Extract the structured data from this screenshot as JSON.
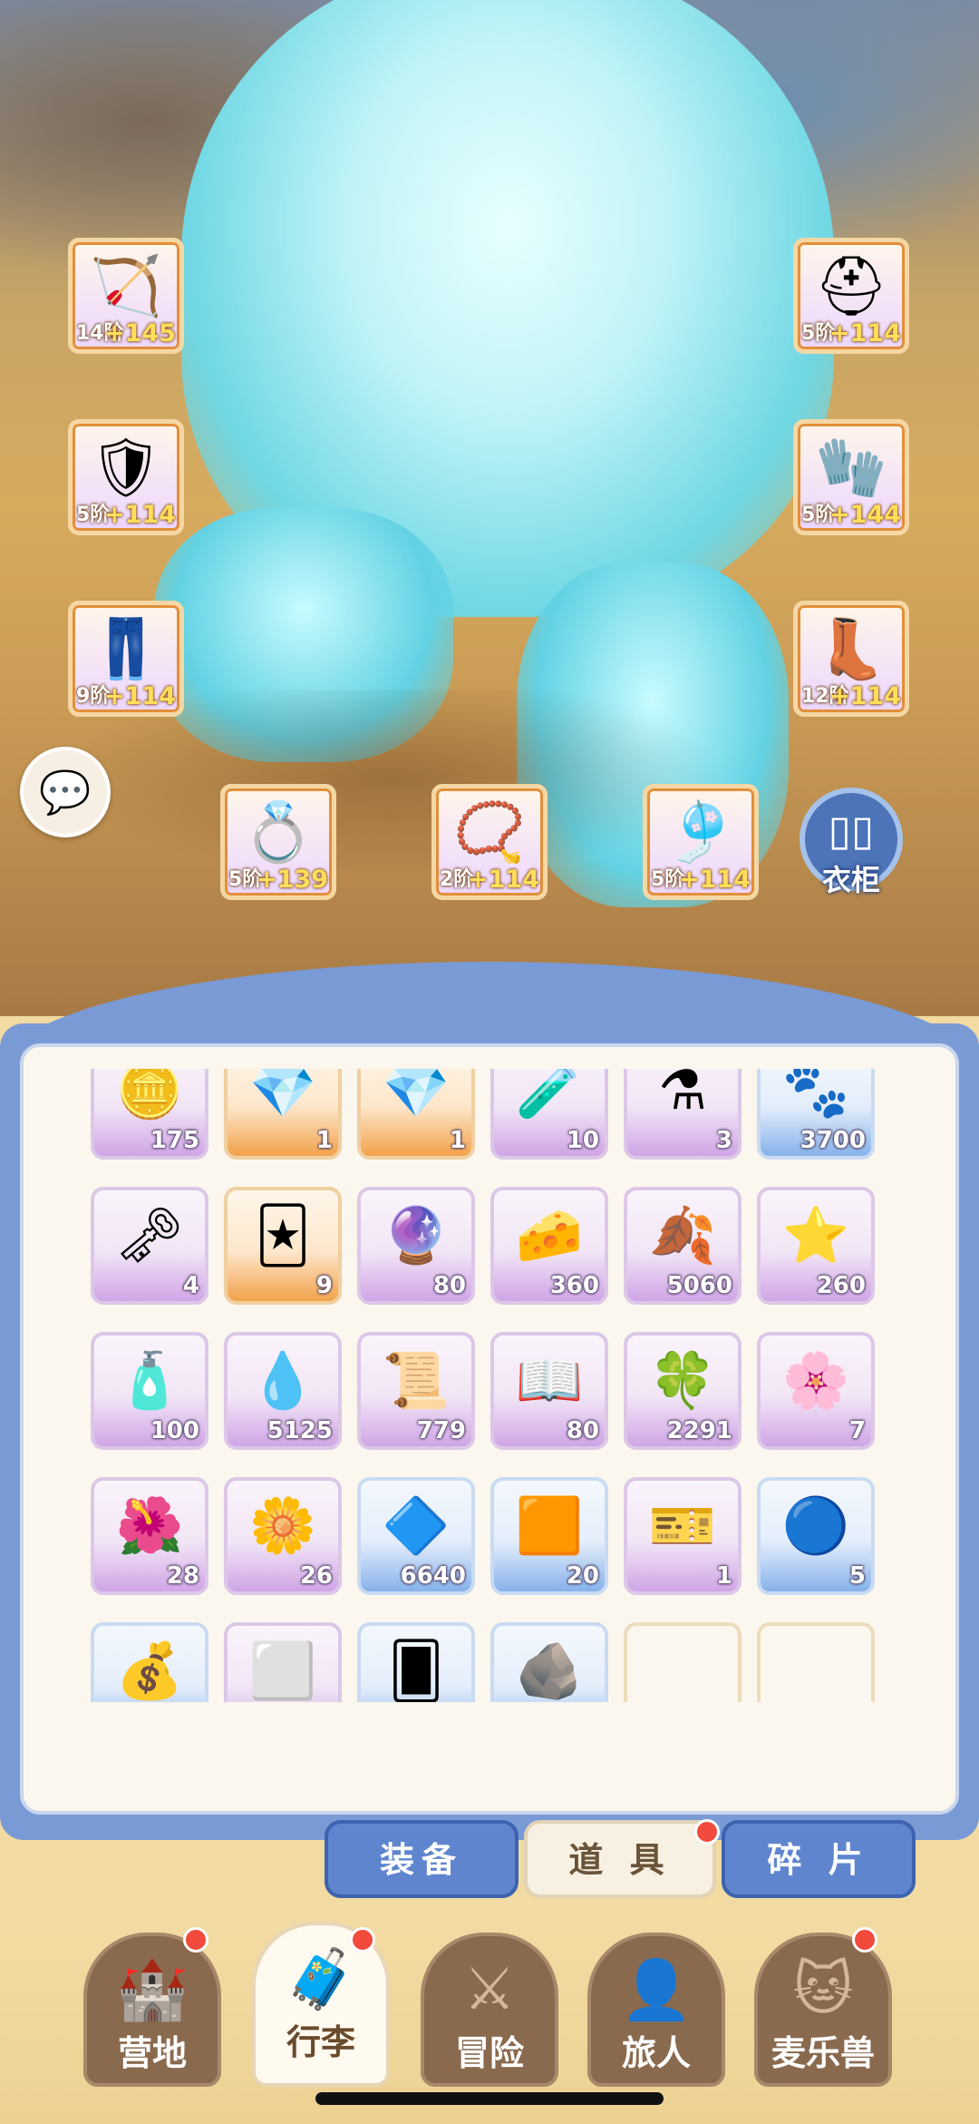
{
  "equipment": {
    "left": [
      {
        "name": "bow",
        "icon": "🏹",
        "level": "14阶",
        "bonus": "+145"
      },
      {
        "name": "armor",
        "icon": "🛡",
        "level": "5阶",
        "bonus": "+114"
      },
      {
        "name": "pants",
        "icon": "👖",
        "level": "9阶",
        "bonus": "+114"
      }
    ],
    "right": [
      {
        "name": "helmet",
        "icon": "⛑",
        "level": "5阶",
        "bonus": "+114"
      },
      {
        "name": "gauntlet",
        "icon": "🧤",
        "level": "5阶",
        "bonus": "+144"
      },
      {
        "name": "boots",
        "icon": "👢",
        "level": "12阶",
        "bonus": "+114"
      }
    ],
    "bottom": [
      {
        "name": "ring",
        "icon": "💍",
        "level": "5阶",
        "bonus": "+139"
      },
      {
        "name": "necklace",
        "icon": "📿",
        "level": "2阶",
        "bonus": "+114"
      },
      {
        "name": "earring",
        "icon": "🎐",
        "level": "5阶",
        "bonus": "+114"
      }
    ]
  },
  "chat_icon": "speech-bubble-icon",
  "wardrobe": {
    "label": "衣柜",
    "icon": "wardrobe-icon"
  },
  "items": [
    {
      "icon": "🪙",
      "qty": "175",
      "rarity": "purple"
    },
    {
      "icon": "💎",
      "qty": "1",
      "rarity": "orange"
    },
    {
      "icon": "💎",
      "qty": "1",
      "rarity": "orange"
    },
    {
      "icon": "🧪",
      "qty": "10",
      "rarity": "purple"
    },
    {
      "icon": "⚗",
      "qty": "3",
      "rarity": "purple"
    },
    {
      "icon": "🐾",
      "qty": "3700",
      "rarity": "blue"
    },
    {
      "icon": "🗝",
      "qty": "4",
      "rarity": "purple"
    },
    {
      "icon": "🃏",
      "qty": "9",
      "rarity": "orange"
    },
    {
      "icon": "🔮",
      "qty": "80",
      "rarity": "purple"
    },
    {
      "icon": "🧀",
      "qty": "360",
      "rarity": "purple"
    },
    {
      "icon": "🍂",
      "qty": "5060",
      "rarity": "purple"
    },
    {
      "icon": "⭐",
      "qty": "260",
      "rarity": "purple"
    },
    {
      "icon": "🧴",
      "qty": "100",
      "rarity": "purple"
    },
    {
      "icon": "💧",
      "qty": "5125",
      "rarity": "purple"
    },
    {
      "icon": "📜",
      "qty": "779",
      "rarity": "purple"
    },
    {
      "icon": "📖",
      "qty": "80",
      "rarity": "purple"
    },
    {
      "icon": "🍀",
      "qty": "2291",
      "rarity": "purple"
    },
    {
      "icon": "🌸",
      "qty": "7",
      "rarity": "purple"
    },
    {
      "icon": "🌺",
      "qty": "28",
      "rarity": "purple"
    },
    {
      "icon": "🌼",
      "qty": "26",
      "rarity": "purple"
    },
    {
      "icon": "🔷",
      "qty": "6640",
      "rarity": "blue"
    },
    {
      "icon": "🟧",
      "qty": "20",
      "rarity": "blue"
    },
    {
      "icon": "🎫",
      "qty": "1",
      "rarity": "purple"
    },
    {
      "icon": "🔵",
      "qty": "5",
      "rarity": "blue"
    },
    {
      "icon": "💰",
      "qty": "",
      "rarity": "blue"
    },
    {
      "icon": "⬜",
      "qty": "",
      "rarity": "purple"
    },
    {
      "icon": "🂠",
      "qty": "",
      "rarity": "blue"
    },
    {
      "icon": "🪨",
      "qty": "",
      "rarity": "blue"
    },
    {
      "icon": "",
      "qty": "",
      "rarity": "empty"
    },
    {
      "icon": "",
      "qty": "",
      "rarity": "empty"
    }
  ],
  "tabs": {
    "equipment": "装备",
    "items": "道 具",
    "fragments": "碎 片"
  },
  "nav": [
    {
      "label": "营地",
      "icon": "🏰"
    },
    {
      "label": "行李",
      "icon": "🧳"
    },
    {
      "label": "冒险",
      "icon": "⚔"
    },
    {
      "label": "旅人",
      "icon": "👤"
    },
    {
      "label": "麦乐兽",
      "icon": "🐱"
    }
  ],
  "colors": {
    "accent_blue": "#5f85cf",
    "badge_red": "#f24a3c"
  }
}
